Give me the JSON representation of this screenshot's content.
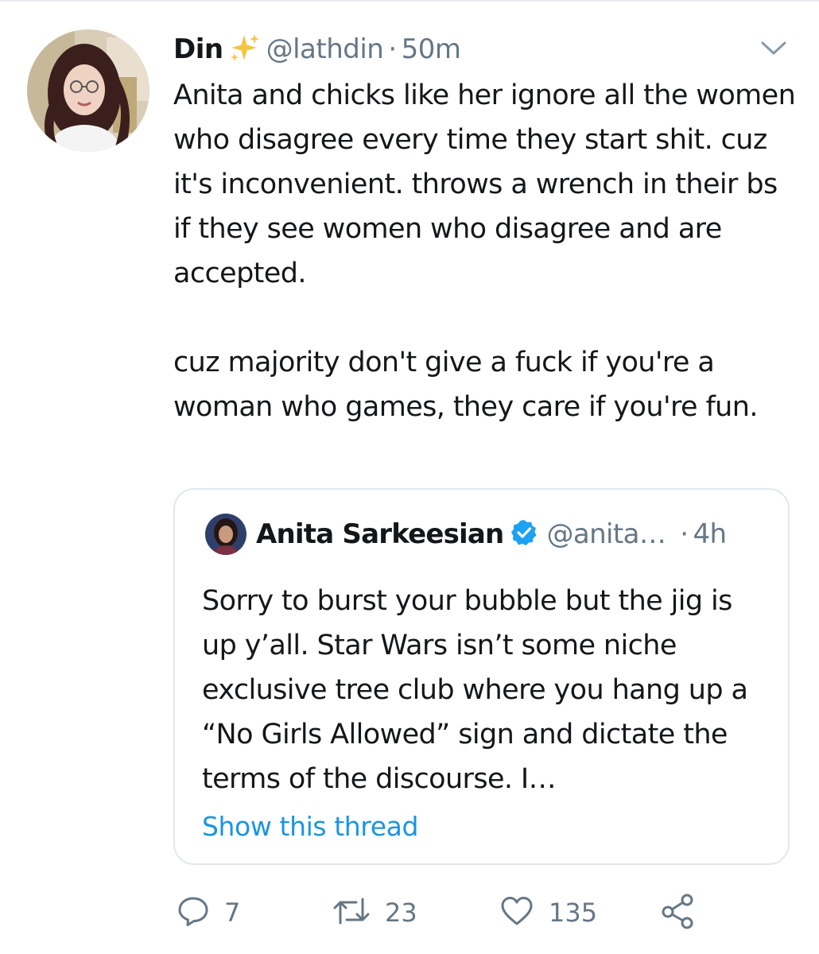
{
  "tweet": {
    "author": {
      "display_name": "Din",
      "name_emoji": "sparkles-icon",
      "handle": "@lathdin",
      "time": "50m"
    },
    "separator": "·",
    "text_paragraph_1": "Anita and chicks like her ignore all the women who disagree every time they start shit. cuz it's inconvenient.  throws a wrench in their bs if they see women who disagree and are accepted.",
    "text_paragraph_2": "cuz majority don't give a fuck if you're a woman who games, they care if you're fun.",
    "more_menu_icon": "chevron-down-icon"
  },
  "quoted_tweet": {
    "author": {
      "display_name": "Anita Sarkeesian",
      "verified": true,
      "handle": "@anita…",
      "time": "4h"
    },
    "separator": "·",
    "text": "Sorry to burst your bubble but the jig is up y’all. Star Wars isn’t some niche exclusive tree club where you hang up a “No Girls Allowed” sign and dictate the terms of the discourse. I…",
    "show_thread_label": "Show this thread"
  },
  "actions": {
    "reply_count": "7",
    "retweet_count": "23",
    "like_count": "135",
    "icons": [
      "reply-icon",
      "retweet-icon",
      "like-icon",
      "share-icon"
    ]
  },
  "colors": {
    "text_primary": "#14171a",
    "text_secondary": "#657786",
    "link": "#1b95e0",
    "verified_badge": "#1da1f2",
    "border": "#e1e8ed",
    "sparkle": "#f5c542"
  }
}
